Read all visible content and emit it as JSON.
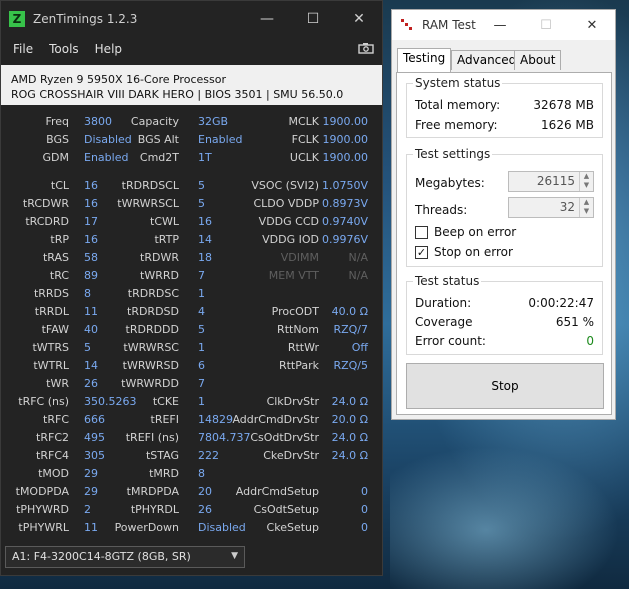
{
  "zen": {
    "title": "ZenTimings 1.2.3",
    "menu": [
      "File",
      "Tools",
      "Help"
    ],
    "cpu": "AMD Ryzen 9 5950X 16-Core Processor",
    "board": "ROG CROSSHAIR VIII DARK HERO | BIOS 3501 | SMU 56.50.0",
    "top": [
      {
        "l1": "Freq",
        "v1": "3800",
        "l2": "Capacity",
        "v2": "32GB",
        "l3": "MCLK",
        "v3": "1900.00"
      },
      {
        "l1": "BGS",
        "v1": "Disabled",
        "l2": "BGS Alt",
        "v2": "Enabled",
        "l3": "FCLK",
        "v3": "1900.00"
      },
      {
        "l1": "GDM",
        "v1": "Enabled",
        "l2": "Cmd2T",
        "v2": "1T",
        "l3": "UCLK",
        "v3": "1900.00"
      }
    ],
    "timings": [
      {
        "l1": "tCL",
        "v1": "16",
        "l2": "tRDRDSCL",
        "v2": "5",
        "l3": "VSOC (SVI2)",
        "v3": "1.0750V"
      },
      {
        "l1": "tRCDWR",
        "v1": "16",
        "l2": "tWRWRSCL",
        "v2": "5",
        "l3": "CLDO VDDP",
        "v3": "0.8973V"
      },
      {
        "l1": "tRCDRD",
        "v1": "17",
        "l2": "tCWL",
        "v2": "16",
        "l3": "VDDG CCD",
        "v3": "0.9740V"
      },
      {
        "l1": "tRP",
        "v1": "16",
        "l2": "tRTP",
        "v2": "14",
        "l3": "VDDG IOD",
        "v3": "0.9976V"
      },
      {
        "l1": "tRAS",
        "v1": "58",
        "l2": "tRDWR",
        "v2": "18",
        "l3": "VDIMM",
        "v3": "N/A"
      },
      {
        "l1": "tRC",
        "v1": "89",
        "l2": "tWRRD",
        "v2": "7",
        "l3": "MEM VTT",
        "v3": "N/A"
      },
      {
        "l1": "tRRDS",
        "v1": "8",
        "l2": "tRDRDSC",
        "v2": "1",
        "l3": "",
        "v3": ""
      },
      {
        "l1": "tRRDL",
        "v1": "11",
        "l2": "tRDRDSD",
        "v2": "4",
        "l3": "ProcODT",
        "v3": "40.0 Ω"
      },
      {
        "l1": "tFAW",
        "v1": "40",
        "l2": "tRDRDDD",
        "v2": "5",
        "l3": "RttNom",
        "v3": "RZQ/7"
      },
      {
        "l1": "tWTRS",
        "v1": "5",
        "l2": "tWRWRSC",
        "v2": "1",
        "l3": "RttWr",
        "v3": "Off"
      },
      {
        "l1": "tWTRL",
        "v1": "14",
        "l2": "tWRWRSD",
        "v2": "6",
        "l3": "RttPark",
        "v3": "RZQ/5"
      },
      {
        "l1": "tWR",
        "v1": "26",
        "l2": "tWRWRDD",
        "v2": "7",
        "l3": "",
        "v3": ""
      },
      {
        "l1": "tRFC (ns)",
        "v1": "350.5263",
        "l2": "tCKE",
        "v2": "1",
        "l3": "ClkDrvStr",
        "v3": "24.0 Ω"
      },
      {
        "l1": "tRFC",
        "v1": "666",
        "l2": "tREFI",
        "v2": "14829",
        "l3": "AddrCmdDrvStr",
        "v3": "20.0 Ω"
      },
      {
        "l1": "tRFC2",
        "v1": "495",
        "l2": "tREFI (ns)",
        "v2": "7804.737",
        "l3": "CsOdtDrvStr",
        "v3": "24.0 Ω"
      },
      {
        "l1": "tRFC4",
        "v1": "305",
        "l2": "tSTAG",
        "v2": "222",
        "l3": "CkeDrvStr",
        "v3": "24.0 Ω"
      },
      {
        "l1": "tMOD",
        "v1": "29",
        "l2": "tMRD",
        "v2": "8",
        "l3": "",
        "v3": ""
      },
      {
        "l1": "tMODPDA",
        "v1": "29",
        "l2": "tMRDPDA",
        "v2": "20",
        "l3": "AddrCmdSetup",
        "v3": "0"
      },
      {
        "l1": "tPHYWRD",
        "v1": "2",
        "l2": "tPHYRDL",
        "v2": "26",
        "l3": "CsOdtSetup",
        "v3": "0"
      },
      {
        "l1": "tPHYWRL",
        "v1": "11",
        "l2": "PowerDown",
        "v2": "Disabled",
        "l3": "CkeSetup",
        "v3": "0"
      }
    ],
    "module": "A1: F4-3200C14-8GTZ (8GB, SR)"
  },
  "ram": {
    "title": "RAM Test",
    "tabs": [
      "Testing",
      "Advanced",
      "About"
    ],
    "system_status": {
      "title": "System status",
      "total_label": "Total memory:",
      "total_value": "32678 MB",
      "free_label": "Free memory:",
      "free_value": "1626 MB"
    },
    "settings": {
      "title": "Test settings",
      "mb_label": "Megabytes:",
      "mb_value": "26115",
      "threads_label": "Threads:",
      "threads_value": "32",
      "beep_label": "Beep on error",
      "beep_checked": false,
      "stop_label": "Stop on error",
      "stop_checked": true
    },
    "status": {
      "title": "Test status",
      "duration_label": "Duration:",
      "duration_value": "0:00:22:47",
      "coverage_label": "Coverage",
      "coverage_value": "651 %",
      "errors_label": "Error count:",
      "errors_value": "0"
    },
    "stop_button": "Stop"
  }
}
